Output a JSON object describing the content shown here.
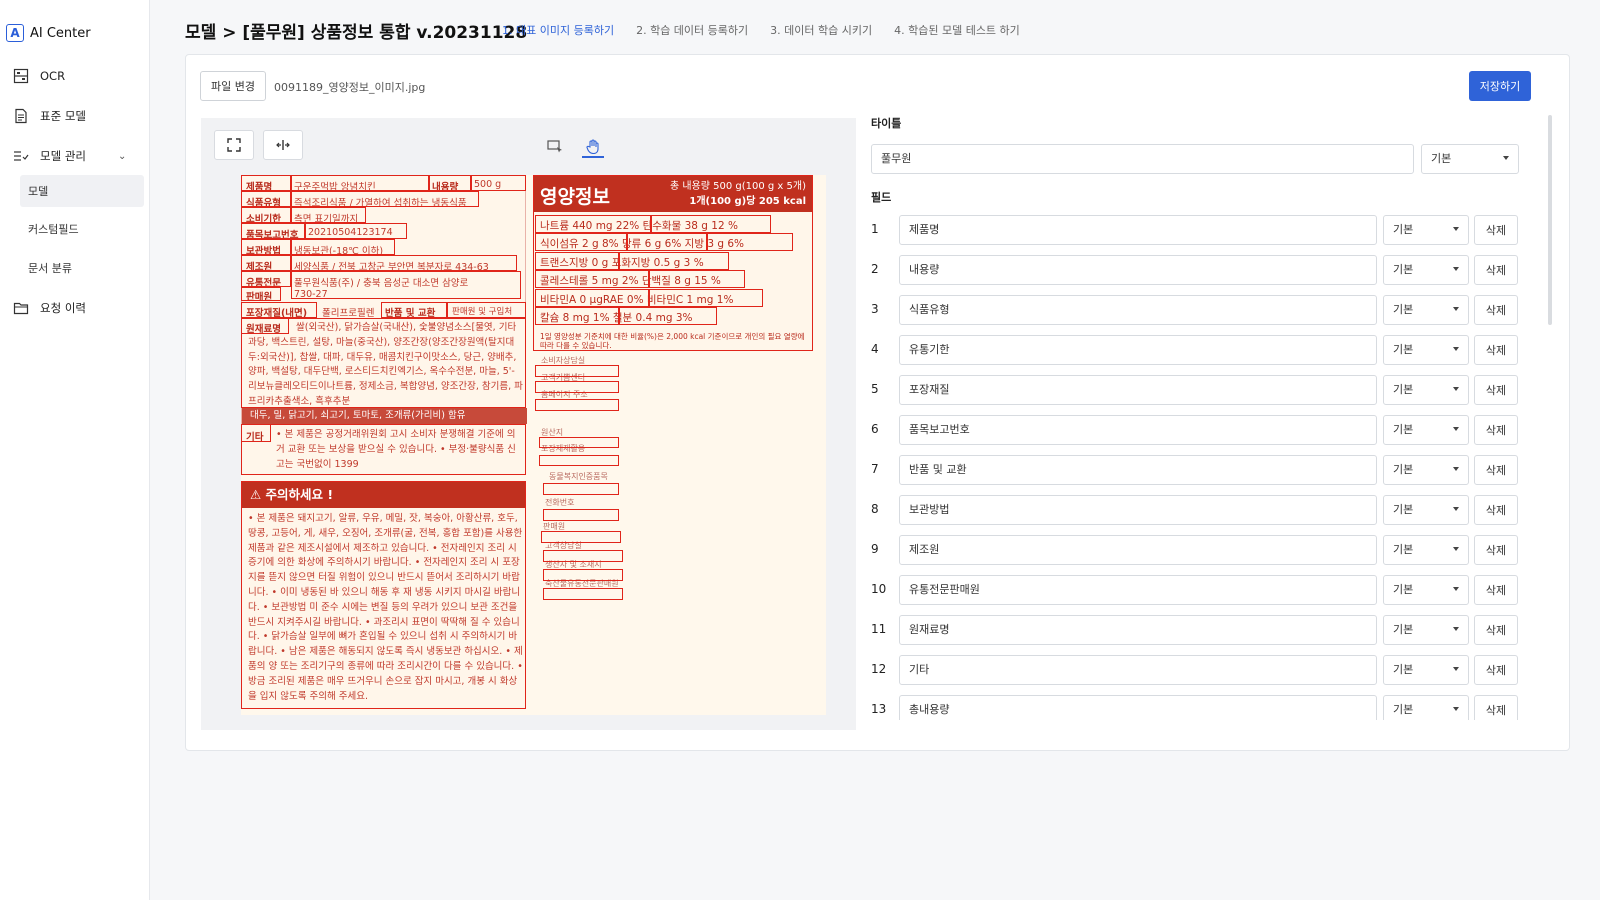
{
  "brand": {
    "logo_letter": "A",
    "name": "AI Center"
  },
  "sidebar": {
    "items": [
      {
        "label": "OCR",
        "icon": "scan-icon"
      },
      {
        "label": "표준 모델",
        "icon": "document-icon"
      },
      {
        "label": "모델 관리",
        "icon": "list-check-icon",
        "expanded": true
      },
      {
        "label": "요청 이력",
        "icon": "folder-icon"
      }
    ],
    "sub_items": [
      {
        "label": "모델",
        "active": true
      },
      {
        "label": "커스텀필드",
        "active": false
      },
      {
        "label": "문서 분류",
        "active": false
      }
    ]
  },
  "header": {
    "title": "모델 > [풀무원] 상품정보 통합 v.20231128",
    "steps": [
      "1. 대표 이미지 등록하기",
      "2. 학습 데이터 등록하기",
      "3. 데이터 학습 시키기",
      "4. 학습된 모델 테스트 하기"
    ],
    "active_step": 0
  },
  "file": {
    "change_label": "파일 변경",
    "name": "0091189_영양정보_이미지.jpg"
  },
  "save_label": "저장하기",
  "label_image": {
    "rows": [
      {
        "label": "제품명",
        "value": "구운주먹밥 앙념치킨"
      },
      {
        "label": "식품유형",
        "value": "즉석조리식품 / 가열하여 섭취하는 냉동식품"
      },
      {
        "label": "소비기한",
        "value": "측면 표기일까지"
      },
      {
        "label": "품목보고번호",
        "value": "20210504123174"
      },
      {
        "label": "보관방법",
        "value": "냉동보관(-18℃ 이하)"
      },
      {
        "label": "제조원",
        "value": "세양식품 / 전북 고창군 부안면 복분자로 434-63"
      },
      {
        "label": "유통전문",
        "value": "풀무원식품(주) / 충북 음성군 대소면 삼양로"
      },
      {
        "label": "판매원",
        "value": "730-27"
      },
      {
        "label": "포장재질(내면)",
        "value": "폴리프로필렌"
      }
    ],
    "content_label": "내용량",
    "content_value": "500 g",
    "return_label": "반품 및 교환",
    "return_value": "판매원 및 구입처",
    "ingredients_label": "원재료명",
    "ingredients": "쌀(외국산), 닭가슴살(국내산), 숯불양념소스[물엿, 기타과당, 백스트린, 설탕, 마늘(중국산), 양조간장(양조간장원액(탈지대두:외국산)], 찹쌀, 대파, 대두유, 매콤치킨구이맛소스, 당근, 양배추, 양파, 백설탕, 대두단백, 로스티드치킨엑기스, 옥수수전분, 마늘, 5'-리보뉴클레오티드이나트륨, 정제소금, 복합양념, 양조간장, 참기름, 파프리카추출색소, 흑후추분",
    "allergy": "대두, 밀, 닭고기, 쇠고기, 토마토, 조개류(가리비) 함유",
    "etc_label": "기타",
    "etc": "• 본 제품은 공정거래위원회 고시 소비자 분쟁해결 기준에 의거 교환 또는 보상을 받으실 수 있습니다. • 부정·불량식품 신고는 국번없이 1399",
    "warning_title": "⚠ 주의하세요 !",
    "warning_text": "• 본 제품은 돼지고기, 알류, 우유, 메밀, 잣, 복숭아, 아황산류, 호두, 땅콩, 고등어, 게, 새우, 오징어, 조개류(굴, 전복, 홍합 포함)를 사용한 제품과 같은 제조시설에서 제조하고 있습니다. • 전자레인지 조리 시 증기에 의한 화상에 주의하시기 바랍니다. • 전자레인지 조리 시 포장지를 뜯지 않으면 터질 위험이 있으니 반드시 뜯어서 조리하시기 바랍니다. • 이미 냉동된 바 있으니 해동 후 재 냉동 시키지 마시길 바랍니다. • 보관방법 미 준수 시에는 변질 등의 우려가 있으니 보관 조건을 반드시 지켜주시길 바랍니다. • 과조리시 표면이 딱딱해 질 수 있습니다. • 닭가슴살 일부에 뼈가 혼입될 수 있으니 섭취 시 주의하시기 바랍니다. • 남은 제품은 해동되지 않도록 즉시 냉동보관 하십시오. • 제품의 양 또는 조리기구의 종류에 따라 조리시간이 다를 수 있습니다. • 방금 조리된 제품은 매우 뜨거우니 손으로 잡지 마시고, 개봉 시 화상을 입지 않도록 주의해 주세요.",
    "nutrition_title": "영양정보",
    "nutrition_total": "총 내용량 500 g(100 g x 5개)",
    "nutrition_per": "1개(100 g)당 205 kcal",
    "nutrition_rows": [
      "나트륨 440 mg  22%   탄수화물 38 g   12 %",
      "식이섬유 2 g  8%   당류 6 g  6%   지방 3 g  6%",
      "트랜스지방 0 g   포화지방 0.5 g  3 %",
      "콜레스테롤 5 mg  2%   단백질 8 g  15 %",
      "비타민A 0 μgRAE  0%   비타민C 1 mg  1%",
      "칼슘 8 mg  1%   철분 0.4 mg  3%"
    ],
    "nutrition_note": "1일 영양성분 기준치에 대한 비율(%)은 2,000 kcal 기준이므로 개인의 필요 열량에 따라 다를 수 있습니다.",
    "mini_labels": [
      "소비자상담실",
      "고객기쁨센터",
      "홈페이지 주소",
      "원산지",
      "포장재재활용",
      "동물복지인증품목",
      "전화번호",
      "판매원",
      "고객상담실",
      "생산자 및 소재지",
      "축산물유통전문판매원"
    ]
  },
  "right_panel": {
    "title_label": "타이틀",
    "title_value": "풀무원",
    "title_select": "기본",
    "fields_label": "필드",
    "fields": [
      {
        "num": "1",
        "name": "제품명",
        "type": "기본",
        "delete": "삭제"
      },
      {
        "num": "2",
        "name": "내용량",
        "type": "기본",
        "delete": "삭제"
      },
      {
        "num": "3",
        "name": "식품유형",
        "type": "기본",
        "delete": "삭제"
      },
      {
        "num": "4",
        "name": "유통기한",
        "type": "기본",
        "delete": "삭제"
      },
      {
        "num": "5",
        "name": "포장재질",
        "type": "기본",
        "delete": "삭제"
      },
      {
        "num": "6",
        "name": "품목보고번호",
        "type": "기본",
        "delete": "삭제"
      },
      {
        "num": "7",
        "name": "반품 및 교환",
        "type": "기본",
        "delete": "삭제"
      },
      {
        "num": "8",
        "name": "보관방법",
        "type": "기본",
        "delete": "삭제"
      },
      {
        "num": "9",
        "name": "제조원",
        "type": "기본",
        "delete": "삭제"
      },
      {
        "num": "10",
        "name": "유통전문판매원",
        "type": "기본",
        "delete": "삭제"
      },
      {
        "num": "11",
        "name": "원재료명",
        "type": "기본",
        "delete": "삭제"
      },
      {
        "num": "12",
        "name": "기타",
        "type": "기본",
        "delete": "삭제"
      },
      {
        "num": "13",
        "name": "총내용량",
        "type": "기본",
        "delete": "삭제"
      }
    ]
  },
  "colors": {
    "accent": "#2f63d8",
    "ocr_box": "#e0251a",
    "label_red": "#c0301f"
  }
}
